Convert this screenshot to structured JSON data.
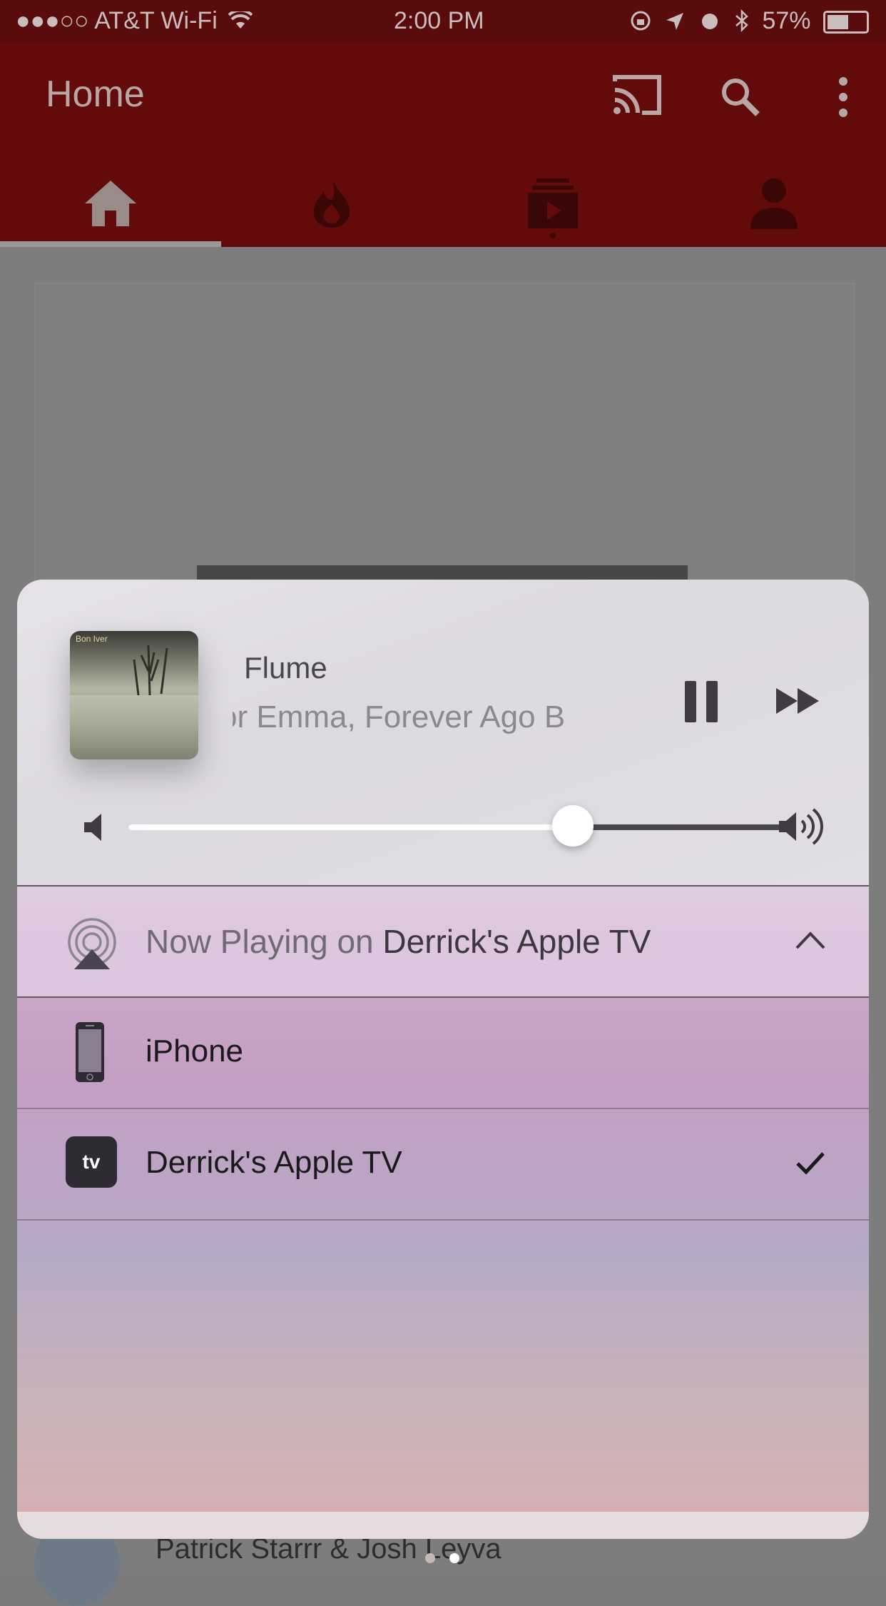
{
  "status_bar": {
    "signal": "●●●○○",
    "carrier": "AT&T Wi-Fi",
    "time": "2:00 PM",
    "battery": "57%"
  },
  "app": {
    "title": "Home",
    "tabs": [
      "home",
      "trending",
      "subscriptions",
      "account"
    ],
    "active_tab": "home",
    "feed": {
      "channel_name": "Patrick Starrr & Josh Leyva"
    },
    "colors": {
      "header": "#630b0b",
      "statusbar": "#5a0b0b"
    }
  },
  "now_playing": {
    "title": "Flume",
    "subtitle": "or Emma, Forever Ago    B",
    "album_art_text": "Bon Iver",
    "volume_level": 0.68,
    "route": {
      "prefix": "Now Playing on ",
      "device": "Derrick's Apple TV"
    },
    "devices": [
      {
        "name": "iPhone",
        "icon": "iphone-icon",
        "selected": false
      },
      {
        "name": "Derrick's Apple TV",
        "icon": "apple-tv-icon",
        "badge": "tv",
        "selected": true
      }
    ]
  }
}
